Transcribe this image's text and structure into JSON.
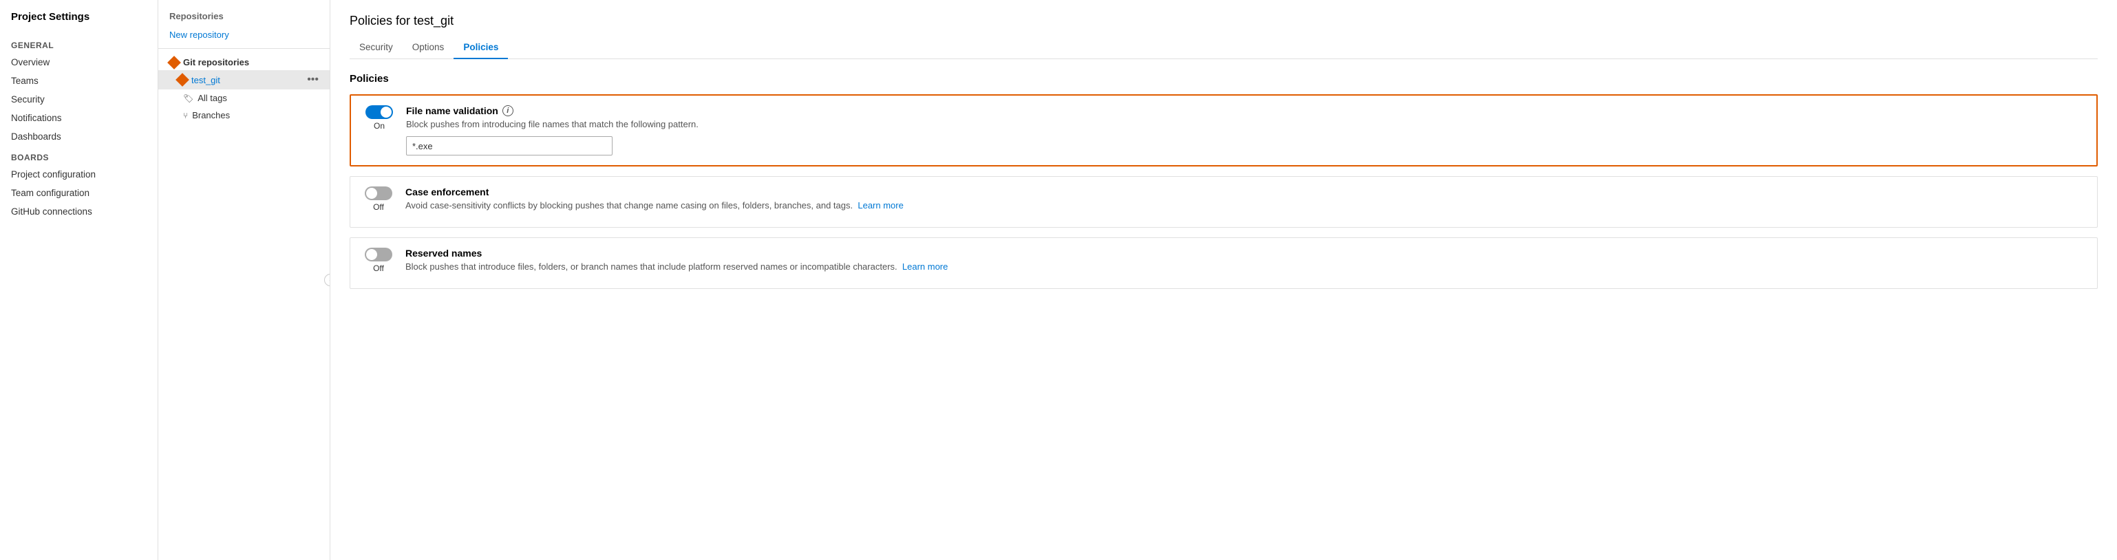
{
  "sidebar": {
    "title": "Project Settings",
    "sections": [
      {
        "name": "General",
        "items": [
          {
            "id": "overview",
            "label": "Overview"
          },
          {
            "id": "teams",
            "label": "Teams"
          },
          {
            "id": "security",
            "label": "Security"
          },
          {
            "id": "notifications",
            "label": "Notifications"
          },
          {
            "id": "dashboards",
            "label": "Dashboards"
          }
        ]
      },
      {
        "name": "Boards",
        "items": [
          {
            "id": "project-configuration",
            "label": "Project configuration"
          },
          {
            "id": "team-configuration",
            "label": "Team configuration"
          },
          {
            "id": "github-connections",
            "label": "GitHub connections"
          }
        ]
      }
    ]
  },
  "middle_panel": {
    "repos_label": "Repositories",
    "new_repo_label": "New repository",
    "git_repos_label": "Git repositories",
    "active_repo": "test_git",
    "sub_items": [
      {
        "id": "all-tags",
        "label": "All tags",
        "icon": "🏷"
      },
      {
        "id": "branches",
        "label": "Branches",
        "icon": "⑂"
      }
    ]
  },
  "main": {
    "page_title": "Policies for test_git",
    "tabs": [
      {
        "id": "security",
        "label": "Security"
      },
      {
        "id": "options",
        "label": "Options"
      },
      {
        "id": "policies",
        "label": "Policies",
        "active": true
      }
    ],
    "policies_heading": "Policies",
    "policies": [
      {
        "id": "file-name-validation",
        "toggle_state": "on",
        "toggle_label": "On",
        "title": "File name validation",
        "has_info": true,
        "description": "Block pushes from introducing file names that match the following pattern.",
        "input_value": "*.exe",
        "highlighted": true
      },
      {
        "id": "case-enforcement",
        "toggle_state": "off",
        "toggle_label": "Off",
        "title": "Case enforcement",
        "has_info": false,
        "description": "Avoid case-sensitivity conflicts by blocking pushes that change name casing on files, folders, branches, and tags.",
        "learn_more_text": "Learn more",
        "highlighted": false
      },
      {
        "id": "reserved-names",
        "toggle_state": "off",
        "toggle_label": "Off",
        "title": "Reserved names",
        "has_info": false,
        "description": "Block pushes that introduce files, folders, or branch names that include platform reserved names or incompatible characters.",
        "learn_more_text": "Learn more",
        "highlighted": false
      }
    ]
  }
}
